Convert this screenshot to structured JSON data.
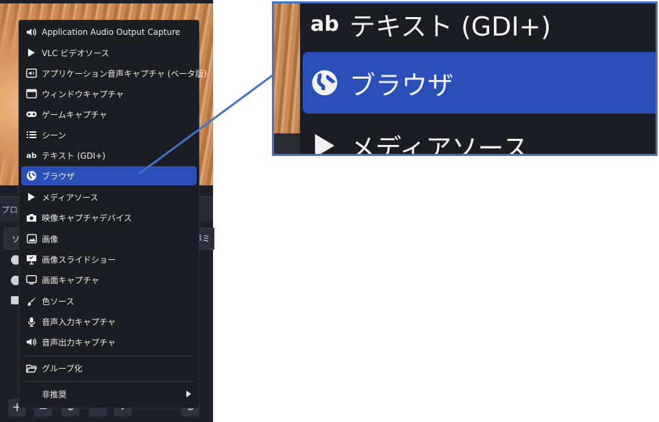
{
  "background": {
    "properties_label": "プロパ",
    "sources_header": "ソ",
    "audio_mixer_header": "声ミ",
    "toolbar": {
      "add_label": "+"
    }
  },
  "menu": {
    "items": [
      {
        "label": "Application Audio Output Capture",
        "icon": "speaker-icon"
      },
      {
        "label": "VLC ビデオソース",
        "icon": "play-icon"
      },
      {
        "label": "アプリケーション音声キャプチャ (ベータ版)",
        "icon": "app-audio-icon"
      },
      {
        "label": "ウィンドウキャプチャ",
        "icon": "window-icon"
      },
      {
        "label": "ゲームキャプチャ",
        "icon": "gamepad-icon"
      },
      {
        "label": "シーン",
        "icon": "list-icon"
      },
      {
        "label": "テキスト (GDI+)",
        "icon": "text-ab-icon"
      },
      {
        "label": "ブラウザ",
        "icon": "globe-icon",
        "selected": true
      },
      {
        "label": "メディアソース",
        "icon": "play-icon"
      },
      {
        "label": "映像キャプチャデバイス",
        "icon": "camera-icon"
      },
      {
        "label": "画像",
        "icon": "image-icon"
      },
      {
        "label": "画像スライドショー",
        "icon": "slideshow-icon"
      },
      {
        "label": "画面キャプチャ",
        "icon": "monitor-icon"
      },
      {
        "label": "色ソース",
        "icon": "paintbrush-icon"
      },
      {
        "label": "音声入力キャプチャ",
        "icon": "microphone-icon"
      },
      {
        "label": "音声出力キャプチャ",
        "icon": "speaker-icon"
      }
    ],
    "group_label": "グループ化",
    "deprecated_label": "非推奨"
  },
  "zoom": {
    "items": [
      {
        "label": "テキスト (GDI+)",
        "icon": "text-ab-icon"
      },
      {
        "label": "ブラウザ",
        "icon": "globe-icon",
        "selected": true
      },
      {
        "label": "メディアソース",
        "icon": "play-icon"
      }
    ]
  },
  "colors": {
    "menu_bg": "#1b1d24",
    "selected_bg": "#2a4fb8",
    "callout_border": "#4472c4"
  }
}
